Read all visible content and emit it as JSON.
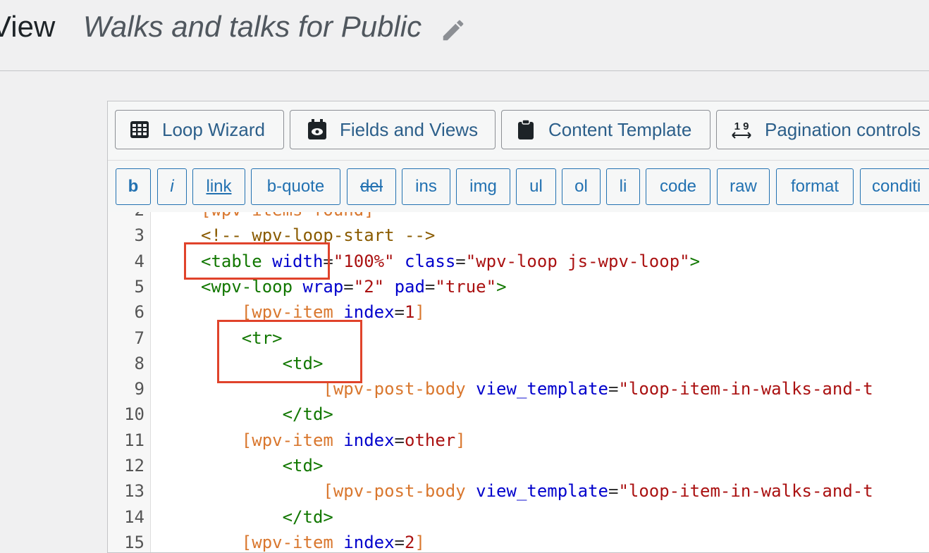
{
  "header": {
    "view_label": "View",
    "title": "Walks and talks for Public"
  },
  "toolbar": [
    {
      "label": "Loop Wizard",
      "icon": "grid-icon"
    },
    {
      "label": "Fields and Views",
      "icon": "calendar-eye-icon"
    },
    {
      "label": "Content Template",
      "icon": "clipboard-icon"
    },
    {
      "label": "Pagination controls",
      "icon": "pagination-icon",
      "icon_text": "1 9"
    }
  ],
  "quicktags": [
    "b",
    "i",
    "link",
    "b-quote",
    "del",
    "ins",
    "img",
    "ul",
    "ol",
    "li",
    "code",
    "raw",
    "format",
    "conditi"
  ],
  "code_lines": [
    {
      "n": "2",
      "parts": [
        {
          "t": "[wpv-items-found]",
          "c": "sc"
        }
      ]
    },
    {
      "n": "3",
      "parts": [
        {
          "t": "<!-- wpv-loop-start -->",
          "c": "cm"
        }
      ]
    },
    {
      "n": "4",
      "parts": [
        {
          "t": "<table ",
          "c": "tag"
        },
        {
          "t": "width",
          "c": "attr"
        },
        {
          "t": "=",
          "c": "plain"
        },
        {
          "t": "\"100%\"",
          "c": "str"
        },
        {
          "t": " ",
          "c": "plain"
        },
        {
          "t": "class",
          "c": "attr"
        },
        {
          "t": "=",
          "c": "plain"
        },
        {
          "t": "\"wpv-loop js-wpv-loop\"",
          "c": "str"
        },
        {
          "t": ">",
          "c": "tag"
        }
      ]
    },
    {
      "n": "5",
      "parts": [
        {
          "t": "<wpv-loop ",
          "c": "tag"
        },
        {
          "t": "wrap",
          "c": "attr"
        },
        {
          "t": "=",
          "c": "plain"
        },
        {
          "t": "\"2\"",
          "c": "str"
        },
        {
          "t": " ",
          "c": "plain"
        },
        {
          "t": "pad",
          "c": "attr"
        },
        {
          "t": "=",
          "c": "plain"
        },
        {
          "t": "\"true\"",
          "c": "str"
        },
        {
          "t": ">",
          "c": "tag"
        }
      ]
    },
    {
      "n": "6",
      "parts": [
        {
          "t": "    [wpv-item ",
          "c": "sc"
        },
        {
          "t": "index",
          "c": "attr"
        },
        {
          "t": "=",
          "c": "plain"
        },
        {
          "t": "1",
          "c": "str"
        },
        {
          "t": "]",
          "c": "sc"
        }
      ]
    },
    {
      "n": "7",
      "parts": [
        {
          "t": "    <tr>",
          "c": "tag"
        }
      ]
    },
    {
      "n": "8",
      "parts": [
        {
          "t": "        <td>",
          "c": "tag"
        }
      ]
    },
    {
      "n": "9",
      "parts": [
        {
          "t": "            [wpv-post-body ",
          "c": "sc"
        },
        {
          "t": "view_template",
          "c": "attr"
        },
        {
          "t": "=",
          "c": "plain"
        },
        {
          "t": "\"loop-item-in-walks-and-t",
          "c": "str"
        }
      ]
    },
    {
      "n": "10",
      "parts": [
        {
          "t": "        </td>",
          "c": "tag"
        }
      ]
    },
    {
      "n": "11",
      "parts": [
        {
          "t": "    [wpv-item ",
          "c": "sc"
        },
        {
          "t": "index",
          "c": "attr"
        },
        {
          "t": "=",
          "c": "plain"
        },
        {
          "t": "other",
          "c": "str"
        },
        {
          "t": "]",
          "c": "sc"
        }
      ]
    },
    {
      "n": "12",
      "parts": [
        {
          "t": "        <td>",
          "c": "tag"
        }
      ]
    },
    {
      "n": "13",
      "parts": [
        {
          "t": "            [wpv-post-body ",
          "c": "sc"
        },
        {
          "t": "view_template",
          "c": "attr"
        },
        {
          "t": "=",
          "c": "plain"
        },
        {
          "t": "\"loop-item-in-walks-and-t",
          "c": "str"
        }
      ]
    },
    {
      "n": "14",
      "parts": [
        {
          "t": "        </td>",
          "c": "tag"
        }
      ]
    },
    {
      "n": "15",
      "parts": [
        {
          "t": "    [wpv-item ",
          "c": "sc"
        },
        {
          "t": "index",
          "c": "attr"
        },
        {
          "t": "=",
          "c": "plain"
        },
        {
          "t": "2",
          "c": "str"
        },
        {
          "t": "]",
          "c": "sc"
        }
      ]
    }
  ],
  "colors": {
    "highlight_box": "#e0432b",
    "button_text": "#2271b1",
    "tag": "#117700",
    "attr": "#0000cc",
    "string": "#aa1111",
    "shortcode": "#d9772e",
    "comment": "#8a5b00"
  }
}
